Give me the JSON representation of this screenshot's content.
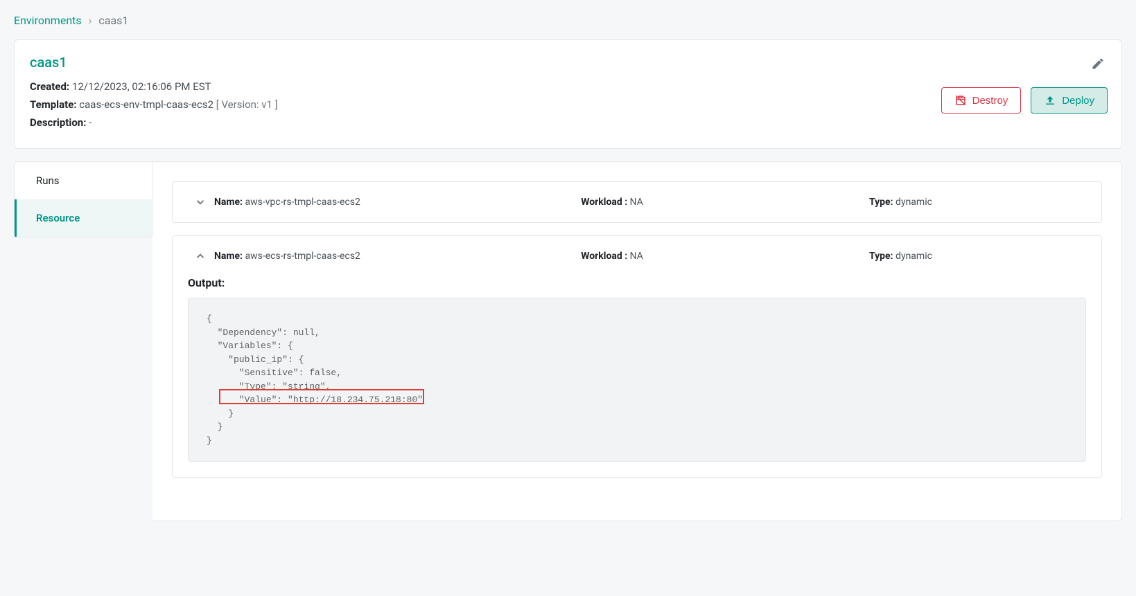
{
  "breadcrumb": {
    "root": "Environments",
    "separator": "›",
    "current": "caas1"
  },
  "header": {
    "title": "caas1",
    "created_label": "Created:",
    "created_value": "12/12/2023, 02:16:06 PM EST",
    "template_label": "Template:",
    "template_value": "caas-ecs-env-tmpl-caas-ecs2",
    "template_version": "[ Version: v1 ]",
    "description_label": "Description:",
    "description_value": "-",
    "destroy_label": "Destroy",
    "deploy_label": "Deploy"
  },
  "sidebar": {
    "tabs": [
      {
        "label": "Runs"
      },
      {
        "label": "Resource"
      }
    ]
  },
  "resources": [
    {
      "name_label": "Name:",
      "name": "aws-vpc-rs-tmpl-caas-ecs2",
      "workload_label": "Workload :",
      "workload": "NA",
      "type_label": "Type:",
      "type": "dynamic"
    },
    {
      "name_label": "Name:",
      "name": "aws-ecs-rs-tmpl-caas-ecs2",
      "workload_label": "Workload :",
      "workload": "NA",
      "type_label": "Type:",
      "type": "dynamic"
    }
  ],
  "output": {
    "label": "Output:",
    "json_text": "{\n  \"Dependency\": null,\n  \"Variables\": {\n    \"public_ip\": {\n      \"Sensitive\": false,\n      \"Type\": \"string\",\n      \"Value\": \"http://18.234.75.218:80\"\n    }\n  }\n}"
  }
}
